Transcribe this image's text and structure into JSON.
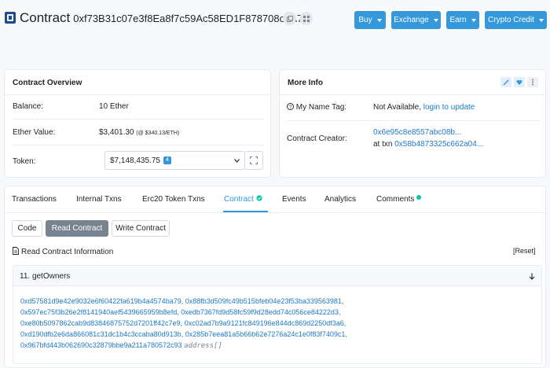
{
  "header": {
    "title": "Contract",
    "address": "0xf73B31c07e3f8Ea8f7c59Ac58ED1F878708c8A76",
    "buttons": [
      {
        "label": "Buy"
      },
      {
        "label": "Exchange"
      },
      {
        "label": "Earn"
      },
      {
        "label": "Crypto Credit"
      }
    ],
    "icons": [
      "copy-icon",
      "qr-code-icon"
    ]
  },
  "overview": {
    "title": "Contract Overview",
    "balance_label": "Balance:",
    "balance_value": "10 Ether",
    "ether_value_label": "Ether Value:",
    "ether_value": "$3,401.30",
    "ether_rate": "(@ $340.13/ETH)",
    "token_label": "Token:",
    "token_value": "$7,148,435.75",
    "token_count": "4"
  },
  "more_info": {
    "title": "More Info",
    "name_tag_label": "My Name Tag:",
    "name_tag_value": "Not Available,",
    "name_tag_link": "login to update",
    "creator_label": "Contract Creator:",
    "creator_address": "0x6e95c8e8557abc08b...",
    "creator_txn_prefix": "at txn",
    "creator_txn": "0x58b4873325c662a04...",
    "icons": [
      "magic-wand-icon",
      "heart-icon",
      "more-vertical-icon"
    ]
  },
  "tabs": {
    "items": [
      {
        "label": "Transactions"
      },
      {
        "label": "Internal Txns"
      },
      {
        "label": "Erc20 Token Txns"
      },
      {
        "label": "Contract"
      },
      {
        "label": "Events"
      },
      {
        "label": "Analytics"
      },
      {
        "label": "Comments"
      }
    ],
    "active": "Contract"
  },
  "contract": {
    "sub_buttons": [
      {
        "label": "Code"
      },
      {
        "label": "Read Contract"
      },
      {
        "label": "Write Contract"
      }
    ],
    "info_label": "Read Contract Information",
    "reset_label": "[Reset]",
    "function_title": "11. getOwners",
    "owners": [
      "0xd57581d9e42e9032e6f60422fa619b4a4574ba79",
      "0x88fb3d509fc49b515bfeb04e23f53ba339563981",
      "0x597ec75f3b26e2f8141940aef5439665959b8efd",
      "0xedb7367fd9d58fc59f9d28edd74c056ce84222d3",
      "0xe80b5097862cab9d83846875752d7201ff42c7e9",
      "0xc02ad7b9a9121fc849196e844dc869d2250df3a6",
      "0xd190dfb2e6da866081c31dc1b4c3ccaba80d913b",
      "0x285b7eea81a5b66b62e7276a24c1e0f83f7409c1",
      "0x967bfd443b062690c32879bbe9a211a780572c93"
    ],
    "return_type": "address[]"
  },
  "colors": {
    "accent": "#3498db",
    "link": "#1e79c6",
    "active_tab_dot": "#00c9a7"
  }
}
